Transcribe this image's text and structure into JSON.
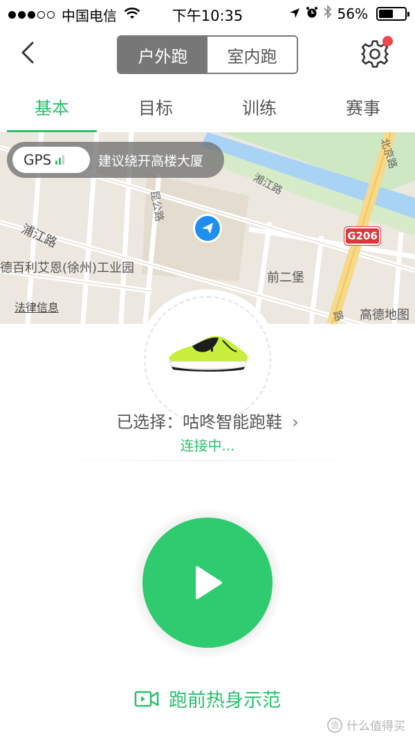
{
  "status_bar": {
    "carrier": "中国电信",
    "time": "下午10:35",
    "battery_percent_label": "56%",
    "battery_level": 0.56
  },
  "nav": {
    "segments": [
      "户外跑",
      "室内跑"
    ],
    "active_segment": 0
  },
  "tabs": [
    "基本",
    "目标",
    "训练",
    "赛事"
  ],
  "active_tab": 0,
  "map": {
    "gps_label": "GPS",
    "gps_hint": "建议绕开高楼大厦",
    "labels": {
      "xiangjiang": "湘江路",
      "kungong": "昆公路",
      "pujiang": "浦江路",
      "company": "德百利艾恩(徐州)工业园",
      "qianerbao": "前二堡",
      "beijing": "北京路",
      "bottom_road": "路"
    },
    "road_shield": "G206",
    "legal": "法律信息",
    "provider": "高德地图"
  },
  "device": {
    "selected_text": "已选择：咕咚智能跑鞋",
    "chevron": "›",
    "status": "连接中..."
  },
  "warmup": {
    "label": "跑前热身示范"
  },
  "watermark": {
    "icon_text": "值",
    "text": "什么值得买"
  },
  "colors": {
    "accent": "#2bbf6c",
    "start_button": "#2ecb6f",
    "segment_active": "#777777",
    "location_marker": "#1e8ff0",
    "road_shield": "#d9383e",
    "notification_dot": "#f0474b"
  }
}
